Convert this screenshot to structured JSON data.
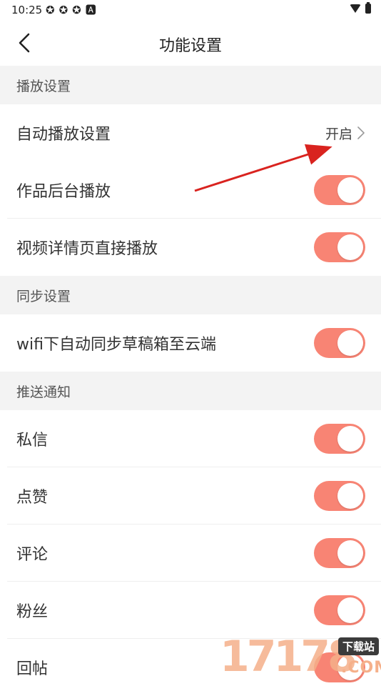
{
  "status_bar": {
    "time": "10:25",
    "notification_icons": [
      "notif-app-icon",
      "notif-app-icon",
      "notif-app-icon",
      "notif-a-icon"
    ]
  },
  "header": {
    "title": "功能设置"
  },
  "sections": [
    {
      "title": "播放设置",
      "rows": [
        {
          "label": "自动播放设置",
          "type": "value",
          "value": "开启"
        },
        {
          "label": "作品后台播放",
          "type": "toggle",
          "on": true
        },
        {
          "label": "视频详情页直接播放",
          "type": "toggle",
          "on": true
        }
      ]
    },
    {
      "title": "同步设置",
      "rows": [
        {
          "label": "wifi下自动同步草稿箱至云端",
          "type": "toggle",
          "on": true
        }
      ]
    },
    {
      "title": "推送通知",
      "rows": [
        {
          "label": "私信",
          "type": "toggle",
          "on": true
        },
        {
          "label": "点赞",
          "type": "toggle",
          "on": true
        },
        {
          "label": "评论",
          "type": "toggle",
          "on": true
        },
        {
          "label": "粉丝",
          "type": "toggle",
          "on": true
        },
        {
          "label": "回帖",
          "type": "toggle",
          "on": true
        }
      ]
    }
  ],
  "colors": {
    "toggle_on": "#f88474",
    "section_bg": "#f3f3f3",
    "annotation_arrow": "#d9231f"
  },
  "watermark": {
    "digits": "17178",
    "badge": "下载站",
    "suffix": ".COM"
  }
}
